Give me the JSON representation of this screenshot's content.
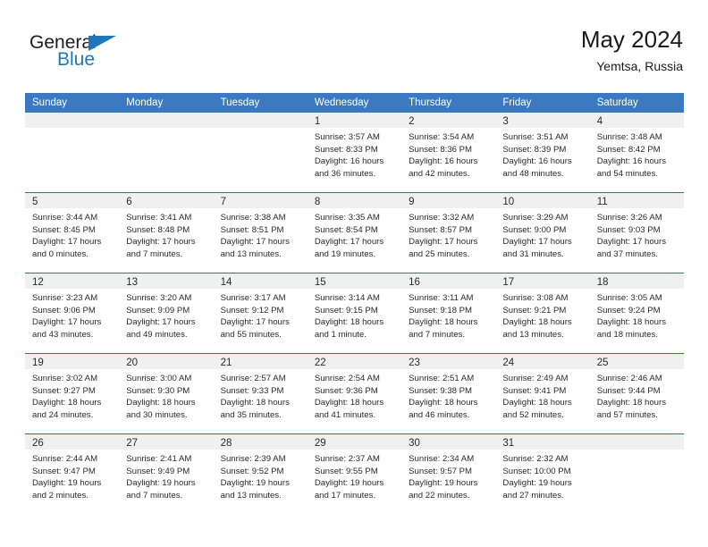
{
  "brand": {
    "name_top": "General",
    "name_bottom": "Blue",
    "triangle_color": "#2277bb"
  },
  "header": {
    "title": "May 2024",
    "subtitle": "Yemtsa, Russia",
    "accent_color": "#3b7ac0"
  },
  "weekdays": [
    "Sunday",
    "Monday",
    "Tuesday",
    "Wednesday",
    "Thursday",
    "Friday",
    "Saturday"
  ],
  "days": [
    {
      "num": "",
      "sunrise": "",
      "sunset": "",
      "daylight": ""
    },
    {
      "num": "",
      "sunrise": "",
      "sunset": "",
      "daylight": ""
    },
    {
      "num": "",
      "sunrise": "",
      "sunset": "",
      "daylight": ""
    },
    {
      "num": "1",
      "sunrise": "Sunrise: 3:57 AM",
      "sunset": "Sunset: 8:33 PM",
      "daylight": "Daylight: 16 hours and 36 minutes."
    },
    {
      "num": "2",
      "sunrise": "Sunrise: 3:54 AM",
      "sunset": "Sunset: 8:36 PM",
      "daylight": "Daylight: 16 hours and 42 minutes."
    },
    {
      "num": "3",
      "sunrise": "Sunrise: 3:51 AM",
      "sunset": "Sunset: 8:39 PM",
      "daylight": "Daylight: 16 hours and 48 minutes."
    },
    {
      "num": "4",
      "sunrise": "Sunrise: 3:48 AM",
      "sunset": "Sunset: 8:42 PM",
      "daylight": "Daylight: 16 hours and 54 minutes."
    },
    {
      "num": "5",
      "sunrise": "Sunrise: 3:44 AM",
      "sunset": "Sunset: 8:45 PM",
      "daylight": "Daylight: 17 hours and 0 minutes."
    },
    {
      "num": "6",
      "sunrise": "Sunrise: 3:41 AM",
      "sunset": "Sunset: 8:48 PM",
      "daylight": "Daylight: 17 hours and 7 minutes."
    },
    {
      "num": "7",
      "sunrise": "Sunrise: 3:38 AM",
      "sunset": "Sunset: 8:51 PM",
      "daylight": "Daylight: 17 hours and 13 minutes."
    },
    {
      "num": "8",
      "sunrise": "Sunrise: 3:35 AM",
      "sunset": "Sunset: 8:54 PM",
      "daylight": "Daylight: 17 hours and 19 minutes."
    },
    {
      "num": "9",
      "sunrise": "Sunrise: 3:32 AM",
      "sunset": "Sunset: 8:57 PM",
      "daylight": "Daylight: 17 hours and 25 minutes."
    },
    {
      "num": "10",
      "sunrise": "Sunrise: 3:29 AM",
      "sunset": "Sunset: 9:00 PM",
      "daylight": "Daylight: 17 hours and 31 minutes."
    },
    {
      "num": "11",
      "sunrise": "Sunrise: 3:26 AM",
      "sunset": "Sunset: 9:03 PM",
      "daylight": "Daylight: 17 hours and 37 minutes."
    },
    {
      "num": "12",
      "sunrise": "Sunrise: 3:23 AM",
      "sunset": "Sunset: 9:06 PM",
      "daylight": "Daylight: 17 hours and 43 minutes."
    },
    {
      "num": "13",
      "sunrise": "Sunrise: 3:20 AM",
      "sunset": "Sunset: 9:09 PM",
      "daylight": "Daylight: 17 hours and 49 minutes."
    },
    {
      "num": "14",
      "sunrise": "Sunrise: 3:17 AM",
      "sunset": "Sunset: 9:12 PM",
      "daylight": "Daylight: 17 hours and 55 minutes."
    },
    {
      "num": "15",
      "sunrise": "Sunrise: 3:14 AM",
      "sunset": "Sunset: 9:15 PM",
      "daylight": "Daylight: 18 hours and 1 minute."
    },
    {
      "num": "16",
      "sunrise": "Sunrise: 3:11 AM",
      "sunset": "Sunset: 9:18 PM",
      "daylight": "Daylight: 18 hours and 7 minutes."
    },
    {
      "num": "17",
      "sunrise": "Sunrise: 3:08 AM",
      "sunset": "Sunset: 9:21 PM",
      "daylight": "Daylight: 18 hours and 13 minutes."
    },
    {
      "num": "18",
      "sunrise": "Sunrise: 3:05 AM",
      "sunset": "Sunset: 9:24 PM",
      "daylight": "Daylight: 18 hours and 18 minutes."
    },
    {
      "num": "19",
      "sunrise": "Sunrise: 3:02 AM",
      "sunset": "Sunset: 9:27 PM",
      "daylight": "Daylight: 18 hours and 24 minutes."
    },
    {
      "num": "20",
      "sunrise": "Sunrise: 3:00 AM",
      "sunset": "Sunset: 9:30 PM",
      "daylight": "Daylight: 18 hours and 30 minutes."
    },
    {
      "num": "21",
      "sunrise": "Sunrise: 2:57 AM",
      "sunset": "Sunset: 9:33 PM",
      "daylight": "Daylight: 18 hours and 35 minutes."
    },
    {
      "num": "22",
      "sunrise": "Sunrise: 2:54 AM",
      "sunset": "Sunset: 9:36 PM",
      "daylight": "Daylight: 18 hours and 41 minutes."
    },
    {
      "num": "23",
      "sunrise": "Sunrise: 2:51 AM",
      "sunset": "Sunset: 9:38 PM",
      "daylight": "Daylight: 18 hours and 46 minutes."
    },
    {
      "num": "24",
      "sunrise": "Sunrise: 2:49 AM",
      "sunset": "Sunset: 9:41 PM",
      "daylight": "Daylight: 18 hours and 52 minutes."
    },
    {
      "num": "25",
      "sunrise": "Sunrise: 2:46 AM",
      "sunset": "Sunset: 9:44 PM",
      "daylight": "Daylight: 18 hours and 57 minutes."
    },
    {
      "num": "26",
      "sunrise": "Sunrise: 2:44 AM",
      "sunset": "Sunset: 9:47 PM",
      "daylight": "Daylight: 19 hours and 2 minutes."
    },
    {
      "num": "27",
      "sunrise": "Sunrise: 2:41 AM",
      "sunset": "Sunset: 9:49 PM",
      "daylight": "Daylight: 19 hours and 7 minutes."
    },
    {
      "num": "28",
      "sunrise": "Sunrise: 2:39 AM",
      "sunset": "Sunset: 9:52 PM",
      "daylight": "Daylight: 19 hours and 13 minutes."
    },
    {
      "num": "29",
      "sunrise": "Sunrise: 2:37 AM",
      "sunset": "Sunset: 9:55 PM",
      "daylight": "Daylight: 19 hours and 17 minutes."
    },
    {
      "num": "30",
      "sunrise": "Sunrise: 2:34 AM",
      "sunset": "Sunset: 9:57 PM",
      "daylight": "Daylight: 19 hours and 22 minutes."
    },
    {
      "num": "31",
      "sunrise": "Sunrise: 2:32 AM",
      "sunset": "Sunset: 10:00 PM",
      "daylight": "Daylight: 19 hours and 27 minutes."
    },
    {
      "num": "",
      "sunrise": "",
      "sunset": "",
      "daylight": ""
    }
  ]
}
